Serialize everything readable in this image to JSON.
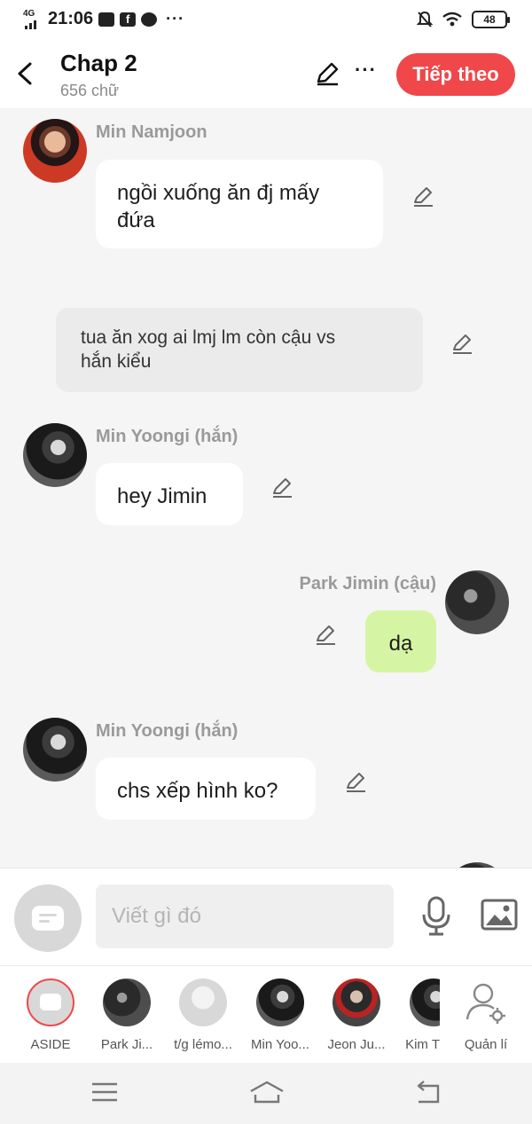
{
  "status": {
    "network": "4G",
    "time": "21:06",
    "battery": "48"
  },
  "header": {
    "title": "Chap 2",
    "word_count": "656 chữ",
    "next_label": "Tiếp theo"
  },
  "messages": [
    {
      "sender": "Min Namjoon",
      "text": "ngồi xuống ăn đj mấy\nđứa"
    },
    {
      "narration": "tua ăn xog ai lmj lm còn cậu vs\nhắn kiểu"
    },
    {
      "sender": "Min Yoongi (hắn)",
      "text": "hey Jimin"
    },
    {
      "sender": "Park Jimin (cậu)",
      "text": "dạ"
    },
    {
      "sender": "Min Yoongi (hắn)",
      "text": "chs xếp hình ko?"
    }
  ],
  "input": {
    "placeholder": "Viết gì đó"
  },
  "characters": [
    {
      "name": "ASIDE"
    },
    {
      "name": "Park Ji..."
    },
    {
      "name": "t/g lémo..."
    },
    {
      "name": "Min Yoo..."
    },
    {
      "name": "Jeon Ju..."
    },
    {
      "name": "Kim T"
    },
    {
      "name": "Quản lí"
    }
  ],
  "colors": {
    "accent": "#f0474b",
    "outgoing_bubble": "#d6f5a4",
    "narration_bg": "#ebebeb"
  }
}
